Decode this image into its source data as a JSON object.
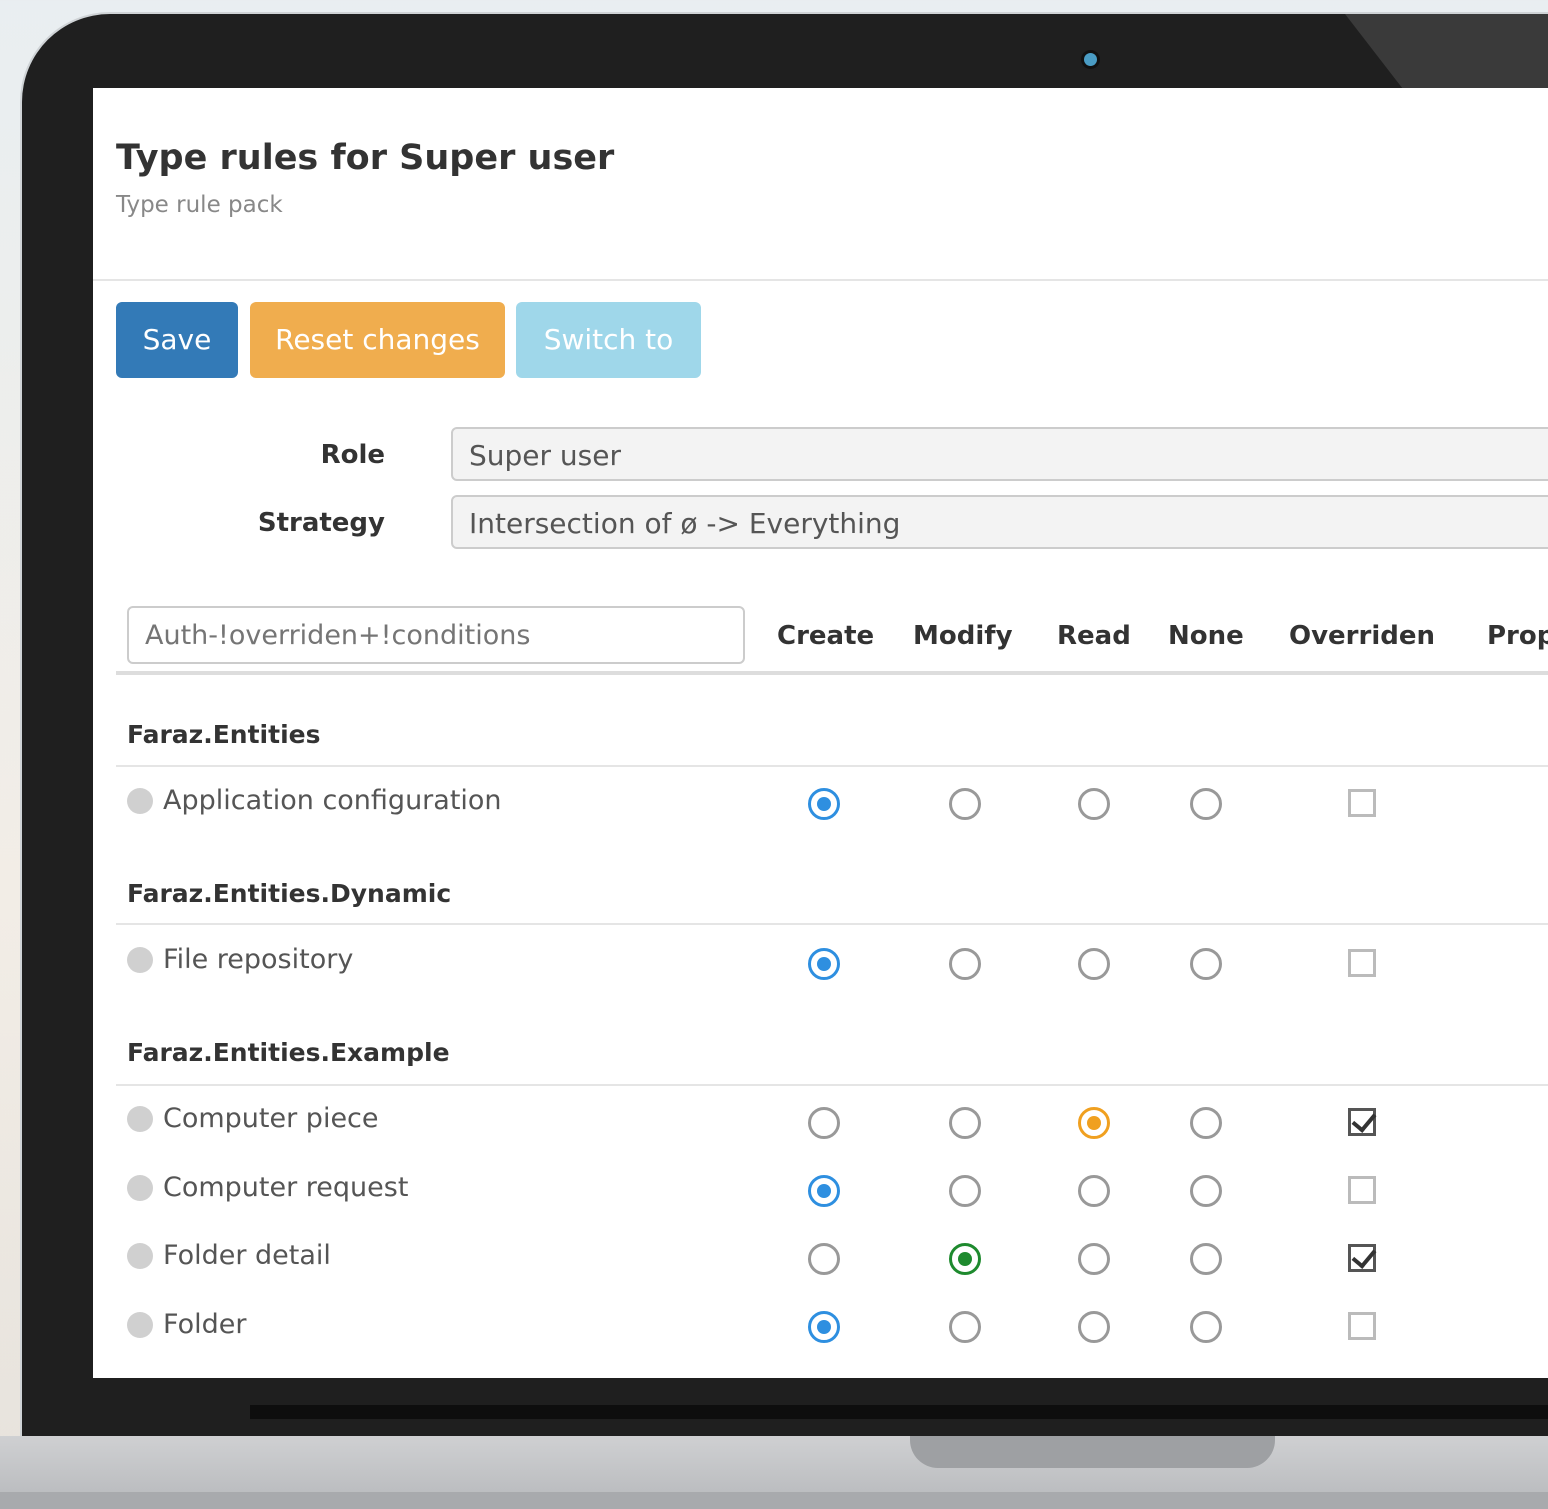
{
  "page": {
    "title": "Type rules for Super user",
    "subtitle": "Type rule pack"
  },
  "toolbar": {
    "save_label": "Save",
    "reset_label": "Reset changes",
    "switch_label": "Switch to"
  },
  "form": {
    "role_label": "Role",
    "role_value": "Super user",
    "strategy_label": "Strategy",
    "strategy_value": "Intersection of ø -> Everything"
  },
  "filter": {
    "placeholder": "Auth-!overriden+!conditions"
  },
  "columns": [
    "Create",
    "Modify",
    "Read",
    "None",
    "Overriden",
    "Prop"
  ],
  "groups": [
    {
      "namespace": "Faraz.Entities",
      "rows": [
        {
          "label": "Application configuration",
          "selected": "Create",
          "color": "#2e8fe0",
          "overriden": false
        }
      ]
    },
    {
      "namespace": "Faraz.Entities.Dynamic",
      "rows": [
        {
          "label": "File repository",
          "selected": "Create",
          "color": "#2e8fe0",
          "overriden": false
        }
      ]
    },
    {
      "namespace": "Faraz.Entities.Example",
      "rows": [
        {
          "label": "Computer piece",
          "selected": "Read",
          "color": "#f0a020",
          "overriden": true
        },
        {
          "label": "Computer request",
          "selected": "Create",
          "color": "#2e8fe0",
          "overriden": false
        },
        {
          "label": "Folder detail",
          "selected": "Modify",
          "color": "#1e8a2e",
          "overriden": true
        },
        {
          "label": "Folder",
          "selected": "Create",
          "color": "#2e8fe0",
          "overriden": false
        }
      ]
    }
  ]
}
